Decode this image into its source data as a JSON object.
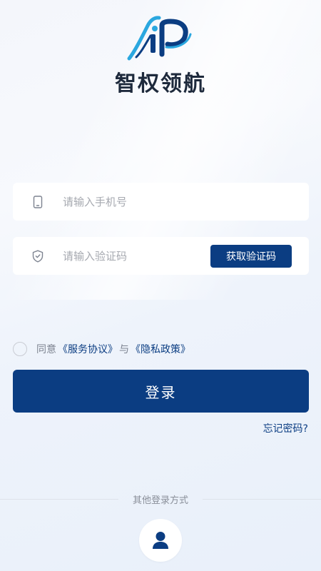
{
  "app": {
    "logo_text": "iP",
    "title": "智权领航"
  },
  "form": {
    "phone": {
      "placeholder": "请输入手机号",
      "value": "",
      "icon": "phone-icon"
    },
    "code": {
      "placeholder": "请输入验证码",
      "value": "",
      "icon": "shield-icon",
      "get_code_label": "获取验证码"
    }
  },
  "agreement": {
    "checked": false,
    "prefix": "同意",
    "service_link": "《服务协议》",
    "joiner": "与",
    "privacy_link": "《隐私政策》"
  },
  "actions": {
    "login_label": "登录",
    "forgot_label": "忘记密码?"
  },
  "other_login": {
    "label": "其他登录方式",
    "icon": "user-icon"
  },
  "colors": {
    "primary": "#0b3d82",
    "logo_blue": "#2aa7df",
    "title": "#1e2a3c",
    "placeholder": "#a6a9b0"
  }
}
